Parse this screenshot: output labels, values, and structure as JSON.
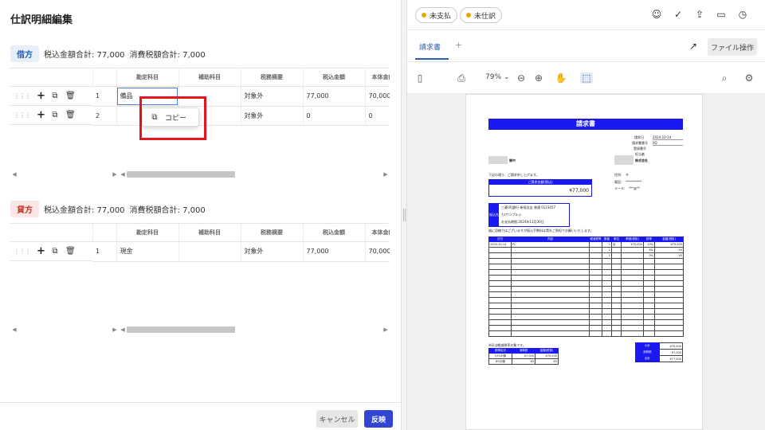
{
  "left": {
    "title": "仕訳明細編集",
    "debit": {
      "badge": "借方",
      "total_incl": "税込金額合計: 77,000",
      "total_tax": "消費税額合計: 7,000",
      "headers": [
        "勘定科目",
        "補助科目",
        "税務摘要",
        "税込金額",
        "本体金額"
      ],
      "rows": [
        {
          "no": "1",
          "account": "備品",
          "sub": "",
          "tax_note": "対象外",
          "amount": "77,000",
          "base": "70,000"
        },
        {
          "no": "2",
          "account": "",
          "sub": "",
          "tax_note": "対象外",
          "amount": "0",
          "base": "0"
        }
      ]
    },
    "credit": {
      "badge": "貸方",
      "total_incl": "税込金額合計: 77,000",
      "total_tax": "消費税額合計: 7,000",
      "headers": [
        "勘定科目",
        "補助科目",
        "税務摘要",
        "税込金額",
        "本体金額"
      ],
      "rows": [
        {
          "no": "1",
          "account": "現金",
          "sub": "",
          "tax_note": "対象外",
          "amount": "77,000",
          "base": "70,000"
        }
      ]
    },
    "context_menu": {
      "copy": "コピー"
    },
    "footer": {
      "cancel": "キャンセル",
      "apply": "反映"
    }
  },
  "right": {
    "status": {
      "unpaid": "未支払",
      "unjournaled": "未仕訳"
    },
    "tabs": {
      "invoice": "請求書",
      "add": "+"
    },
    "file_ops": "ファイル操作",
    "zoom": "79%",
    "invoice": {
      "title": "請求書",
      "date_label": "請求日",
      "date": "2024-10-14",
      "no_label": "請求書番号",
      "no": "0Q",
      "reg_label": "登録番号",
      "staff_label": "担当者",
      "to_suffix": "御中",
      "from_company": "株式会社",
      "intro": "下記の通り、ご請求申し上げます。",
      "amount_label": "ご請求金額(税込)",
      "amount": "¥77,000",
      "tel_label": "住所:",
      "tel_value": "〒",
      "phone_label": "電話:",
      "phone_value": "**********",
      "mail_label": "メール:",
      "mail_value": "***@**",
      "bank_label": "振込先",
      "bank_line1": "三菱UFJ銀行 新宿支店 普通 0123457",
      "bank_line2": "カ)サンプルシ",
      "bank_line3": "お支払期限:2024年11月30日",
      "note": "誠に恐縮ではございますが振込手数料は貴社ご負担でお願いいたします。",
      "item_headers": [
        "日付",
        "内容",
        "軽減税率",
        "数量",
        "単位",
        "単価(税抜)",
        "税率",
        "金額(税抜)"
      ],
      "item_row": {
        "date": "2024-10-14",
        "desc": "PC",
        "qty": "1",
        "unit": "台",
        "price": "¥70,000",
        "rate": "10%",
        "total": "¥70,000"
      },
      "item_row2": {
        "qty": "1",
        "rate": "8%",
        "total": "¥0"
      },
      "item_row3": {
        "qty": "1",
        "rate": "0%",
        "total": "¥0"
      },
      "tax_caption": "※印は軽減税率対象です。",
      "tax_headers": [
        "税率区分",
        "消費税",
        "金額(税抜)"
      ],
      "tax_rows": [
        {
          "label": "10%対象",
          "tax": "¥7,000",
          "amount": "¥70,000"
        },
        {
          "label": "8%対象",
          "tax": "¥0",
          "amount": "¥0"
        }
      ],
      "sum_rows": [
        {
          "label": "小計",
          "value": "¥70,000"
        },
        {
          "label": "消費税",
          "value": "¥7,000"
        },
        {
          "label": "合計",
          "value": "¥77,000"
        }
      ]
    }
  }
}
